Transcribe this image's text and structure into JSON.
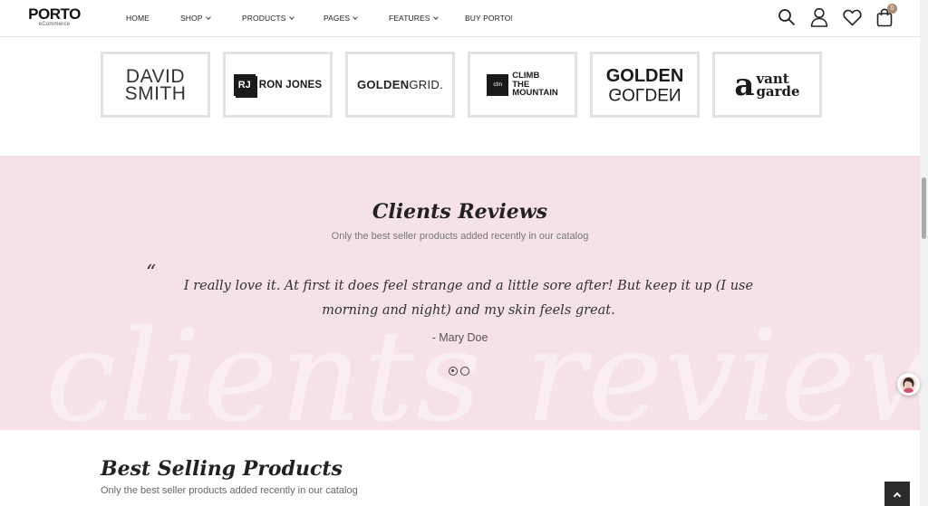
{
  "header": {
    "logo": {
      "main": "PORTO",
      "sub": "eCommerce"
    },
    "nav": [
      {
        "label": "HOME",
        "has_dropdown": false
      },
      {
        "label": "SHOP",
        "has_dropdown": true
      },
      {
        "label": "PRODUCTS",
        "has_dropdown": true
      },
      {
        "label": "PAGES",
        "has_dropdown": true
      },
      {
        "label": "FEATURES",
        "has_dropdown": true
      },
      {
        "label": "BUY PORTO!",
        "has_dropdown": false
      }
    ],
    "icons": [
      "search-icon",
      "user-icon",
      "heart-icon",
      "cart-icon"
    ],
    "cart_count": "0"
  },
  "brands": [
    {
      "name": "david-smith",
      "lines": [
        "DAVID",
        "SMITH"
      ]
    },
    {
      "name": "ron-jones",
      "mark": "RJ",
      "text": "RON JONES"
    },
    {
      "name": "goldengrid",
      "bold": "GOLDEN",
      "light": "GRID."
    },
    {
      "name": "climb-the-mountain",
      "mark": "ctm",
      "lines": [
        "CLIMB",
        "THE",
        "MOUNTAIN"
      ]
    },
    {
      "name": "golden-golden",
      "top": "GOLDEN",
      "bottom": "GOLDEN"
    },
    {
      "name": "avant-garde",
      "mark": "a",
      "lines": [
        "vant",
        "garde"
      ]
    }
  ],
  "reviews": {
    "title": "Clients Reviews",
    "subtitle": "Only the best seller products added recently in our catalog",
    "quote_mark": "“",
    "quote": "I really love it. At first it does feel strange and a little sore after! But keep it up (I use morning and night) and my skin feels great.",
    "author": "- Mary Doe",
    "watermark": "clients reviews",
    "slides": 2,
    "active_slide": 1
  },
  "best_selling": {
    "title": "Best Selling Products",
    "subtitle": "Only the best seller products added recently in our catalog"
  },
  "colors": {
    "reviews_bg": "#f5e1e6",
    "cart_badge": "#a98b74",
    "side_accent": "#20c9b3",
    "back_to_top": "#2b2b2b"
  }
}
